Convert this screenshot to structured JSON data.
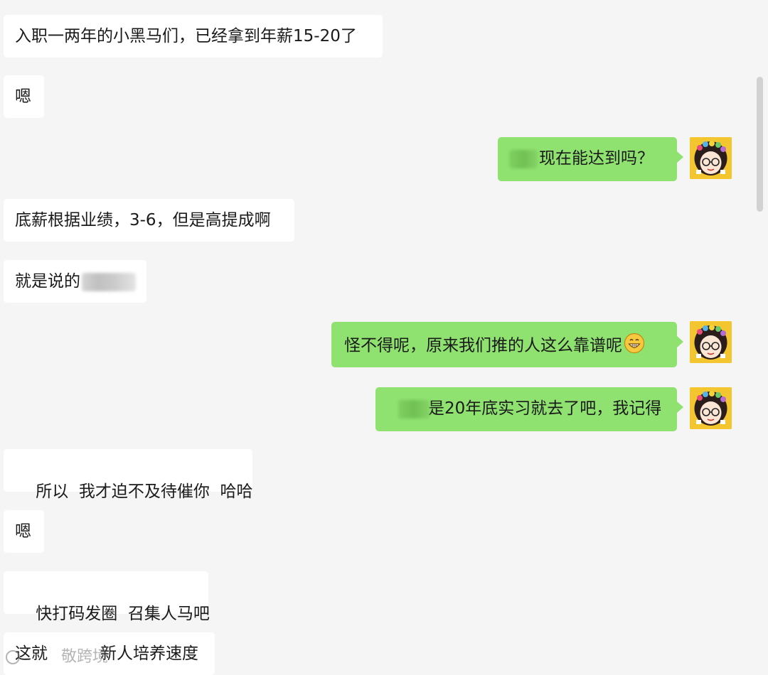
{
  "messages": [
    {
      "side": "in",
      "text": "入职一两年的小黑马们，已经拿到年薪15-20了"
    },
    {
      "side": "in",
      "text": "嗯"
    },
    {
      "side": "out",
      "text": "现在能达到吗？"
    },
    {
      "side": "in",
      "text": "底薪根据业绩，3-6，但是高提成啊"
    },
    {
      "side": "in",
      "text": "就是说的"
    },
    {
      "side": "out",
      "text": "怪不得呢，原来我们推的人这么靠谱呢"
    },
    {
      "side": "out",
      "text": "是20年底实习就去了吧，我记得"
    },
    {
      "side": "in",
      "text": "所以  我才迫不及待催你  哈哈"
    },
    {
      "side": "in",
      "text": "嗯"
    },
    {
      "side": "in",
      "text": "快打码发圈  召集人马吧"
    },
    {
      "side": "in",
      "text_prefix": "这就",
      "text_suffix": "新人培养速度"
    }
  ],
  "watermark": {
    "text": "敬跨境"
  },
  "icons": {
    "avatar": "cartoon-girl-avatar-icon",
    "emoji": "grinning-face-icon",
    "watermark_logo": "circle-logo-icon"
  },
  "colors": {
    "background": "#f5f5f5",
    "incoming_bubble": "#ffffff",
    "outgoing_bubble": "#8fe26f",
    "avatar_bg": "#f3c52e"
  }
}
